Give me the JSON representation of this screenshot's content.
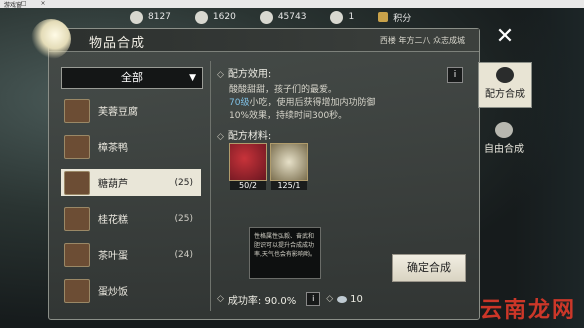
{
  "window": {
    "title": "游戏窗",
    "controls": "– □ ×"
  },
  "currencies": [
    {
      "icon": "silver-coin-icon",
      "value": "8127"
    },
    {
      "icon": "ingot-icon",
      "value": "1620"
    },
    {
      "icon": "gem-icon",
      "value": "45743"
    },
    {
      "icon": "scroll-icon",
      "value": "1"
    },
    {
      "icon": "points-icon",
      "value": "积分"
    }
  ],
  "panel": {
    "title": "物品合成",
    "datetime": "西楼 年方二八 众志成城"
  },
  "category_dropdown": {
    "selected": "全部"
  },
  "items": [
    {
      "name": "芙蓉豆腐",
      "count": ""
    },
    {
      "name": "樟茶鸭",
      "count": ""
    },
    {
      "name": "糖葫芦",
      "count": "(25)",
      "selected": true
    },
    {
      "name": "桂花糕",
      "count": "(25)"
    },
    {
      "name": "茶叶蛋",
      "count": "(24)"
    },
    {
      "name": "蛋炒饭",
      "count": ""
    }
  ],
  "recipe": {
    "effect_label": "配方效用:",
    "effect_line1": "酸酸甜甜，孩子们的最爱。",
    "effect_level": "70级",
    "effect_line2": "小吃，使用后获得增加内功防御",
    "effect_line3": "10%效果，持续时间300秒。",
    "materials_label": "配方材料:",
    "materials": [
      {
        "name": "hawthorn",
        "qty": "50/2"
      },
      {
        "name": "sugar",
        "qty": "125/1"
      }
    ],
    "tooltip": "性格属性弘毅、奋武和胆识可以提升合成成功率,天气也会有影响哟。",
    "success_label": "成功率: 90.0%",
    "cost": "10",
    "confirm_label": "确定合成"
  },
  "tabs": [
    {
      "label": "配方合成",
      "active": true
    },
    {
      "label": "自由合成",
      "active": false
    }
  ],
  "watermark": "云南龙网"
}
